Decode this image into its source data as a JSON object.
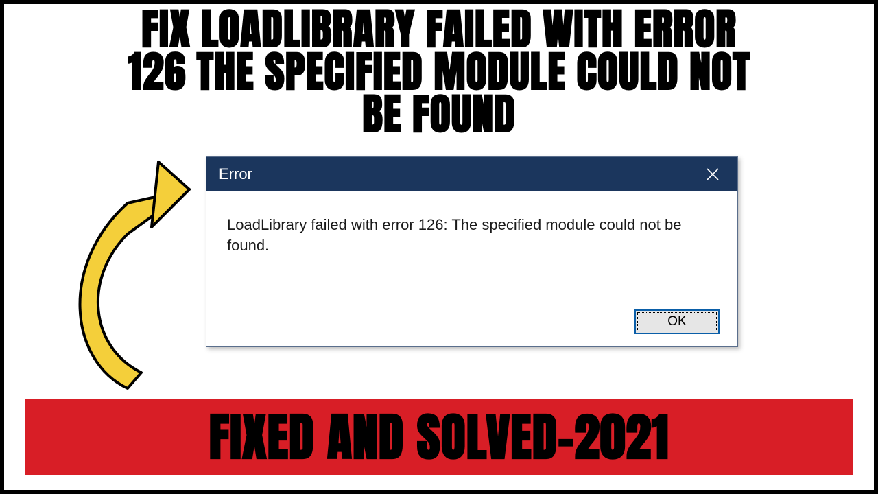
{
  "headline": "FIX LOADLIBRARY FAILED WITH ERROR\n126 THE SPECIFIED MODULE COULD NOT\nBE FOUND",
  "dialog": {
    "title": "Error",
    "message": "LoadLibrary failed with error 126: The specified module could not be found.",
    "ok_label": "OK"
  },
  "banner": "FIXED AND SOLVED-2021",
  "colors": {
    "titlebar": "#1b365d",
    "banner": "#d81e26",
    "arrow": "#f4cf3a"
  }
}
